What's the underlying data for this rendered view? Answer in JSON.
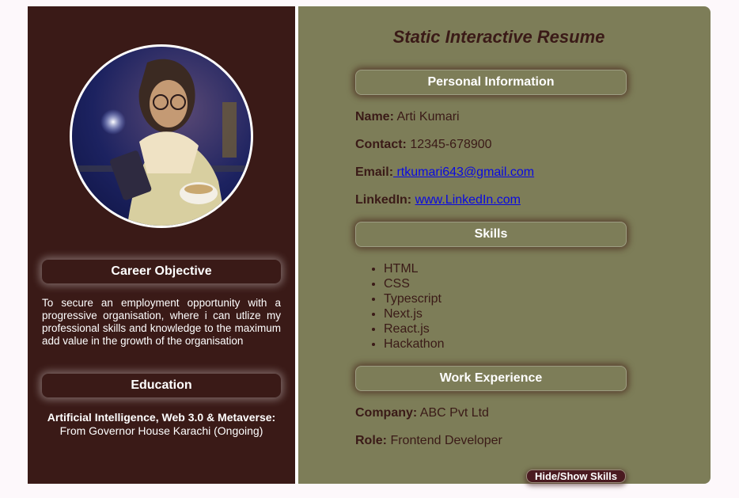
{
  "left": {
    "career_heading": "Career Objective",
    "objective_text": "To secure an employment opportunity with a progressive organisation, where i can utlize my professional skills and knowledge to the maxi­mum add value in the growth of the organisation",
    "education_heading": "Education",
    "education_title": "Artificial Intelligence, Web 3.0 & Metaverse:",
    "education_detail": "From Governor House Karachi (Ongoing)"
  },
  "main": {
    "title": "Static Interactive Resume",
    "personal_heading": "Personal Information",
    "name_label": "Name:",
    "name_value": "Arti Kumari",
    "contact_label": "Contact:",
    "contact_value": "12345-678900",
    "email_label": "Email:",
    "email_value": " rtkumari643@gmail.com",
    "linkedin_label": "LinkedIn:",
    "linkedin_value": "www.LinkedIn.com",
    "skills_heading": "Skills",
    "skills": [
      "HTML",
      "CSS",
      "Typescript",
      "Next.js",
      "React.js",
      "Hackathon"
    ],
    "work_heading": "Work Experience",
    "company_label": "Company:",
    "company_value": "ABC Pvt Ltd",
    "role_label": "Role:",
    "role_value": "Frontend Developer"
  },
  "toggle_button": "Hide/Show Skills",
  "colors": {
    "sidebar": "#3a1a17",
    "main": "#7d7d58",
    "link": "#0a0ae0",
    "button": "#4a1a20"
  }
}
